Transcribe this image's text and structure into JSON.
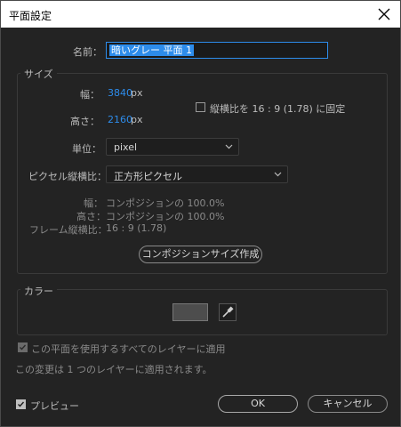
{
  "window": {
    "title": "平面設定"
  },
  "name": {
    "label": "名前：",
    "value": "暗いグレー 平面 1"
  },
  "size": {
    "group_label": "サイズ",
    "width_label": "幅：",
    "width_value": "3840",
    "width_unit": "px",
    "height_label": "高さ：",
    "height_value": "2160",
    "height_unit": "px",
    "aspect_lock_label": "縦横比を 16 : 9 (1.78) に固定",
    "aspect_lock_checked": false,
    "unit_label": "単位：",
    "unit_value": "pixel",
    "pixel_aspect_label": "ピクセル縦横比：",
    "pixel_aspect_value": "正方形ピクセル",
    "info_width_label": "幅：",
    "info_width_value": "コンポジションの 100.0%",
    "info_height_label": "高さ：",
    "info_height_value": "コンポジションの 100.0%",
    "info_frame_label": "フレーム縦横比：",
    "info_frame_value": "16 : 9 (1.78)",
    "comp_size_button": "コンポジションサイズ作成"
  },
  "color": {
    "group_label": "カラー",
    "swatch_color": "#4d4d4d"
  },
  "apply_all": {
    "label": "この平面を使用するすべてのレイヤーに適用",
    "checked": true,
    "enabled": false
  },
  "notice": "この変更は 1 つのレイヤーに適用されます。",
  "preview": {
    "label": "プレビュー",
    "checked": true
  },
  "buttons": {
    "ok": "OK",
    "cancel": "キャンセル"
  },
  "colors": {
    "accent": "#2d8ceb",
    "background": "#232323"
  }
}
